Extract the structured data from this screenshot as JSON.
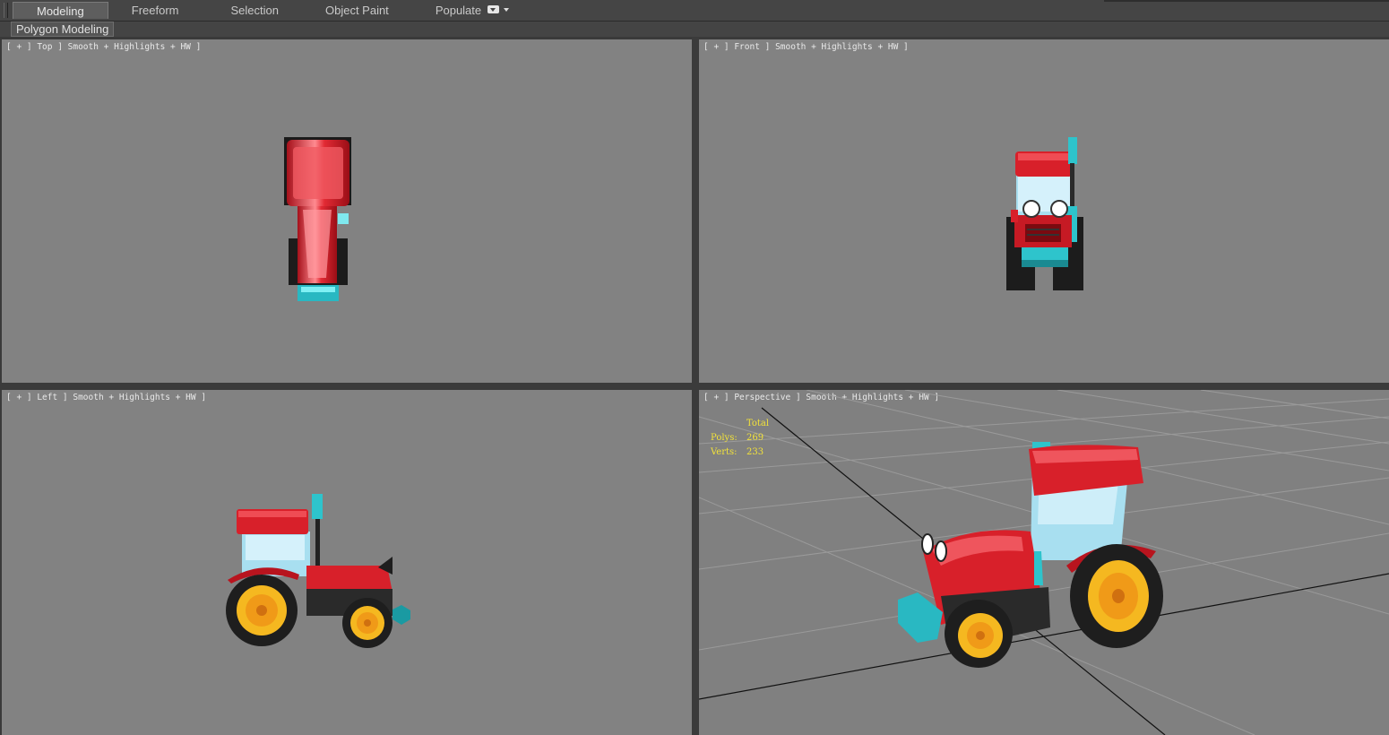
{
  "ribbon": {
    "tabs": [
      {
        "label": "Modeling",
        "active": true
      },
      {
        "label": "Freeform",
        "active": false
      },
      {
        "label": "Selection",
        "active": false
      },
      {
        "label": "Object Paint",
        "active": false
      },
      {
        "label": "Populate",
        "active": false
      }
    ],
    "menu_icon": "ribbon-options-icon",
    "panel_label": "Polygon Modeling"
  },
  "viewports": {
    "top": {
      "label": "[ + ] Top ] Smooth + Highlights + HW ]"
    },
    "front": {
      "label": "[ + ] Front ] Smooth + Highlights + HW ]"
    },
    "left": {
      "label": "[ + ] Left ] Smooth + Highlights + HW ]"
    },
    "perspective": {
      "label": "[ + ] Perspective ] Smooth + Highlights + HW ]",
      "stats": {
        "title": "Total",
        "polys_label": "Polys:",
        "polys_value": "269",
        "verts_label": "Verts:",
        "verts_value": "233"
      }
    }
  },
  "colors": {
    "viewport_bg": "#828282",
    "tractor_body": "#d8202a",
    "tractor_trim": "#2ec4cc",
    "wheel_hub": "#f0b020",
    "stats_text": "#f2e23a"
  }
}
